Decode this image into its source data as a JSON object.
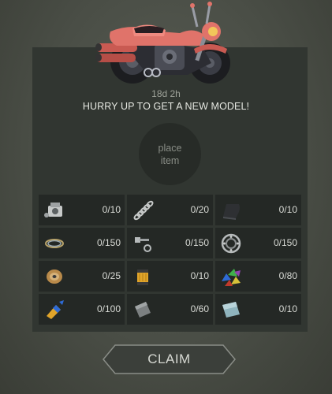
{
  "header": {
    "timer": "18d 2h",
    "message": "HURRY UP TO GET A NEW MODEL!"
  },
  "slot": {
    "line1": "place",
    "line2": "item"
  },
  "resources": [
    {
      "icon": "engine-icon",
      "count": "0/10"
    },
    {
      "icon": "spring-icon",
      "count": "0/20"
    },
    {
      "icon": "seat-icon",
      "count": "0/10"
    },
    {
      "icon": "wire-coil-icon",
      "count": "0/150"
    },
    {
      "icon": "bolt-icon",
      "count": "0/150"
    },
    {
      "icon": "bearing-icon",
      "count": "0/150"
    },
    {
      "icon": "wire-spool-icon",
      "count": "0/25"
    },
    {
      "icon": "fuel-filter-icon",
      "count": "0/10"
    },
    {
      "icon": "gem-pile-icon",
      "count": "0/80"
    },
    {
      "icon": "glue-icon",
      "count": "0/100"
    },
    {
      "icon": "metal-plate-icon",
      "count": "0/60"
    },
    {
      "icon": "glass-plate-icon",
      "count": "0/10"
    }
  ],
  "claim": {
    "label": "CLAIM"
  },
  "colors": {
    "panel": "#313631",
    "cell": "#242825",
    "bike_body": "#e0736a",
    "text": "#e6e8e2"
  }
}
